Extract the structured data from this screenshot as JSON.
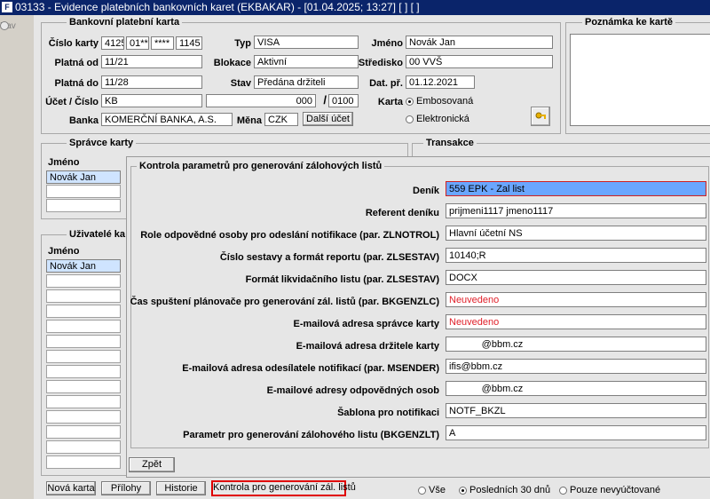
{
  "window": {
    "title": "03133 - Evidence platebních bankovních karet (EKBAKAR) - [01.04.2025; 13:27]  [ ]  [ ]"
  },
  "nav": {
    "label": "Nav"
  },
  "card": {
    "group_title": "Bankovní platební karta",
    "cislo_karty_label": "Číslo karty",
    "cislo_karty": [
      "4125",
      "01**",
      "****",
      "1145"
    ],
    "typ_label": "Typ",
    "typ": "VISA",
    "jmeno_label": "Jméno",
    "jmeno": "Novák Jan",
    "platna_od_label": "Platná od",
    "platna_od": "11/21",
    "blokace_label": "Blokace",
    "blokace": "Aktivní",
    "stredisko_label": "Středisko",
    "stredisko": "00 VVŠ",
    "platna_do_label": "Platná do",
    "platna_do": "11/28",
    "stav_label": "Stav",
    "stav": "Předána držiteli",
    "dat_pr_label": "Dat. př.",
    "dat_pr": "01.12.2021",
    "ucet_label": "Účet / Číslo",
    "ucet": "KB",
    "ucet_cislo": "000",
    "slash": "/",
    "kod_banky": "0100",
    "karta_label": "Karta",
    "karta_opt1": "Embosovaná",
    "karta_opt2": "Elektronická",
    "banka_label": "Banka",
    "banka": "KOMERČNÍ BANKA, A.S.",
    "mena_label": "Měna",
    "mena": "CZK",
    "dalsi_ucet": "Další účet"
  },
  "poznamka": {
    "title": "Poznámka ke kartě"
  },
  "spravce": {
    "title": "Správce karty",
    "col_jmeno": "Jméno",
    "rows": [
      "Novák Jan"
    ]
  },
  "transakce": {
    "title": "Transakce"
  },
  "uzivatele": {
    "title": "Uživatelé ka",
    "col_jmeno": "Jméno",
    "rows": [
      "Novák Jan"
    ]
  },
  "dialog": {
    "title": "Kontrola parametrů pro generování zálohových listů",
    "fields": [
      {
        "label": "Deník",
        "value": "559 EPK - Zal list"
      },
      {
        "label": "Referent deníku",
        "value": "prijmeni1117 jmeno1117"
      },
      {
        "label": "Role odpovědné osoby pro odeslání notifikace (par. ZLNOTROL)",
        "value": "Hlavní účetní NS"
      },
      {
        "label": "Číslo sestavy a formát reportu (par. ZLSESTAV)",
        "value": "10140;R"
      },
      {
        "label": "Formát likvidačního listu (par. ZLSESTAV)",
        "value": "DOCX"
      },
      {
        "label": "Čas spuštení plánovače pro generování zál. listů (par. BKGENZLC)",
        "value": "Neuvedeno"
      },
      {
        "label": "E-mailová adresa správce karty",
        "value": "Neuvedeno"
      },
      {
        "label": "E-mailová adresa držitele karty",
        "value": "            @bbm.cz"
      },
      {
        "label": "E-mailová adresa odesílatele notifikací (par. MSENDER)",
        "value": "ifis@bbm.cz"
      },
      {
        "label": "E-mailové adresy odpovědných osob",
        "value": "            @bbm.cz"
      },
      {
        "label": "Šablona pro notifikaci",
        "value": "NOTF_BKZL"
      },
      {
        "label": "Parametr pro generování zálohového listu (BKGENZLT)",
        "value": "A"
      }
    ],
    "back": "Zpět"
  },
  "bottom": {
    "nova_karta": "Nová karta",
    "prilohy": "Přílohy",
    "historie": "Historie",
    "kontrola": "Kontrola pro generování zál. listů",
    "filter_vse": "Vše",
    "filter_30": "Posledních 30 dnů",
    "filter_neuct": "Pouze nevyúčtované"
  }
}
